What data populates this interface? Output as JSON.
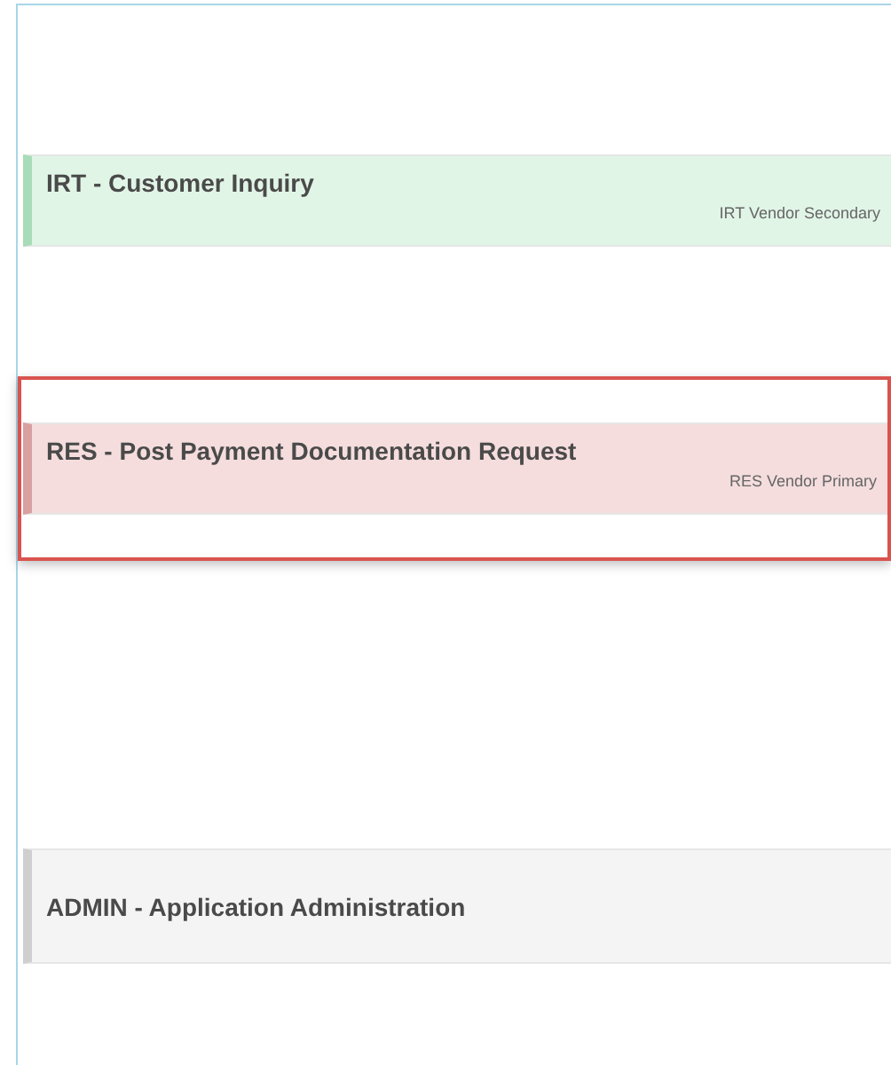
{
  "cards": [
    {
      "title": "IRT - Customer Inquiry",
      "subtitle": "IRT Vendor Secondary",
      "color": "#a8dcb8",
      "selected": false
    },
    {
      "title": "RES - Post Payment Documentation Request",
      "subtitle": "RES Vendor Primary",
      "color": "#d9a0a0",
      "selected": true
    },
    {
      "title": "ADMIN - Application Administration",
      "color": "#cfcfcf",
      "selected": false
    }
  ]
}
